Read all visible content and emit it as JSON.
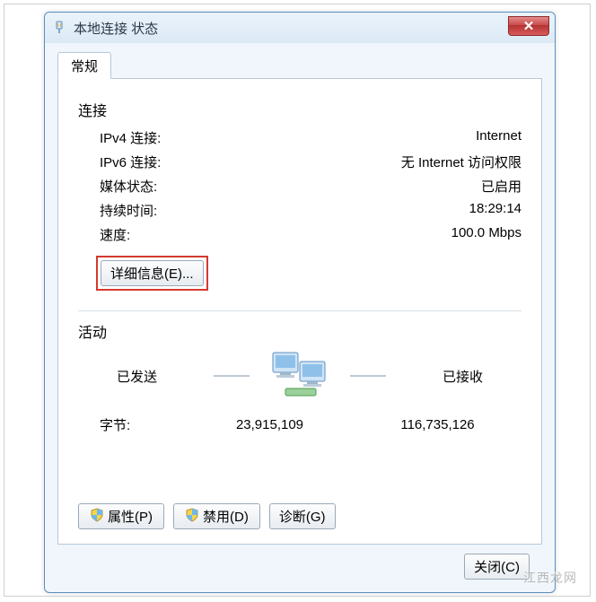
{
  "window": {
    "title": "本地连接 状态",
    "close_glyph": "✕"
  },
  "tab": {
    "general": "常规"
  },
  "connection": {
    "heading": "连接",
    "ipv4_label": "IPv4 连接:",
    "ipv4_value": "Internet",
    "ipv6_label": "IPv6 连接:",
    "ipv6_value": "无 Internet 访问权限",
    "media_label": "媒体状态:",
    "media_value": "已启用",
    "duration_label": "持续时间:",
    "duration_value": "18:29:14",
    "speed_label": "速度:",
    "speed_value": "100.0 Mbps",
    "details_button": "详细信息(E)..."
  },
  "activity": {
    "heading": "活动",
    "sent_label": "已发送",
    "received_label": "已接收",
    "bytes_label": "字节:",
    "sent_value": "23,915,109",
    "received_value": "116,735,126"
  },
  "buttons": {
    "properties": "属性(P)",
    "disable": "禁用(D)",
    "diagnose": "诊断(G)",
    "close": "关闭(C)"
  },
  "watermark": "江西龙网"
}
